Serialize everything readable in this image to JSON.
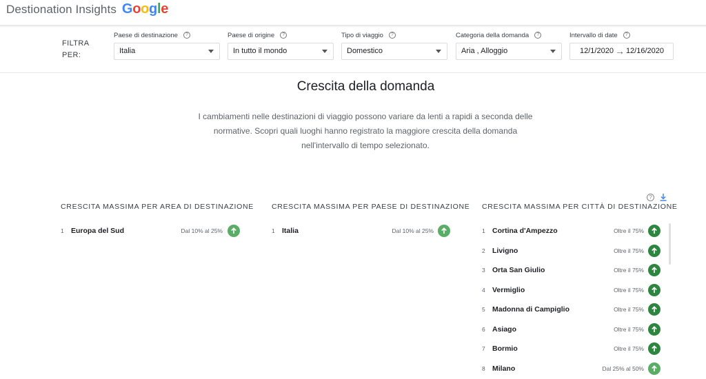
{
  "header": {
    "title": "Destionation Insights",
    "logo": [
      "G",
      "o",
      "o",
      "g",
      "l",
      "e"
    ],
    "logo_colors": [
      "#4285F4",
      "#EA4335",
      "#FBBC05",
      "#4285F4",
      "#34A853",
      "#EA4335"
    ]
  },
  "filters": {
    "label": "FILTRA PER:",
    "destination": {
      "label": "Paese di destinazione",
      "value": "Italia"
    },
    "origin": {
      "label": "Paese di origine",
      "value": "In tutto il mondo"
    },
    "trip_type": {
      "label": "Tipo di viaggio",
      "value": "Domestico"
    },
    "category": {
      "label": "Categoria della domanda",
      "value": "Aria , Alloggio"
    },
    "date_range": {
      "label": "Intervallo di date",
      "start": "12/1/2020",
      "end": "12/16/2020"
    }
  },
  "section": {
    "title": "Crescita della domanda",
    "description": "I cambiamenti nelle destinazioni di viaggio possono variare da lenti a rapidi a seconda delle normative. Scopri quali luoghi hanno registrato la maggiore crescita della domanda nell'intervallo di tempo selezionato."
  },
  "columns": {
    "area": {
      "title": "CRESCITA MASSIMA PER AREA DI DESTINAZIONE",
      "rows": [
        {
          "rank": "1",
          "name": "Europa del Sud",
          "growth": "Dal 10% al 25%",
          "level": "light"
        }
      ]
    },
    "country": {
      "title": "CRESCITA MASSIMA PER PAESE DI DESTINAZIONE",
      "rows": [
        {
          "rank": "1",
          "name": "Italia",
          "growth": "Dal 10% al 25%",
          "level": "light"
        }
      ]
    },
    "city": {
      "title": "CRESCITA MASSIMA PER CITTÀ DI DESTINAZIONE",
      "rows": [
        {
          "rank": "1",
          "name": "Cortina d'Ampezzo",
          "growth": "Oltre il 75%",
          "level": "dark"
        },
        {
          "rank": "2",
          "name": "Livigno",
          "growth": "Oltre il 75%",
          "level": "dark"
        },
        {
          "rank": "3",
          "name": "Orta San Giulio",
          "growth": "Oltre il 75%",
          "level": "dark"
        },
        {
          "rank": "4",
          "name": "Vermiglio",
          "growth": "Oltre il 75%",
          "level": "dark"
        },
        {
          "rank": "5",
          "name": "Madonna di Campiglio",
          "growth": "Oltre il 75%",
          "level": "dark"
        },
        {
          "rank": "6",
          "name": "Asiago",
          "growth": "Oltre il 75%",
          "level": "dark"
        },
        {
          "rank": "7",
          "name": "Bormio",
          "growth": "Oltre il 75%",
          "level": "dark"
        },
        {
          "rank": "8",
          "name": "Milano",
          "growth": "Dal 25% al 50%",
          "level": "light"
        }
      ]
    }
  },
  "colors": {
    "growth_dark": "#2e8540",
    "growth_light": "#5aad67",
    "download": "#4285F4"
  },
  "icons": {
    "help": "help-circle-icon",
    "download": "download-icon",
    "arrow_up": "arrow-up-icon",
    "dropdown": "chevron-down-icon",
    "range_arrow": "arrow-right-icon"
  }
}
